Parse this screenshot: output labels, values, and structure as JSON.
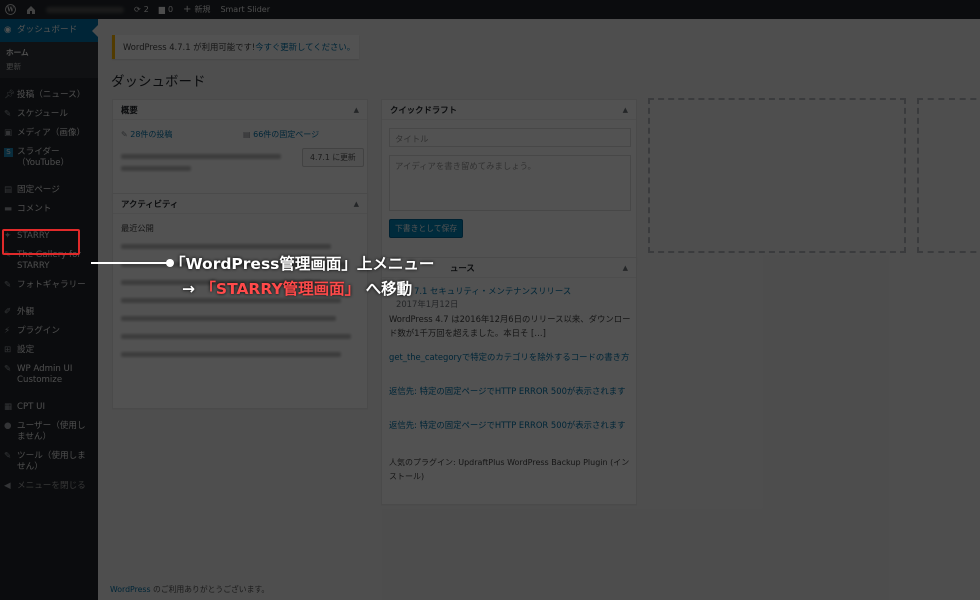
{
  "adminbar": {
    "updates_count": "2",
    "comments_count": "0",
    "new_label": "新規",
    "smart_slider_label": "Smart Slider"
  },
  "sidebar": {
    "dashboard": "ダッシュボード",
    "sub_home": "ホーム",
    "sub_update": "更新",
    "items": [
      {
        "label": "投稿（ニュース）",
        "icon": "pin-icon"
      },
      {
        "label": "スケジュール",
        "icon": "pin-icon"
      },
      {
        "label": "メディア（画像）",
        "icon": "media-icon"
      },
      {
        "label": "スライダー（YouTube）",
        "icon": "slider-icon"
      },
      {
        "label": "固定ページ",
        "icon": "page-icon"
      },
      {
        "label": "コメント",
        "icon": "comment-icon"
      },
      {
        "label": "STARRY",
        "icon": "starry-icon"
      },
      {
        "label": "The Gallery for STARRY",
        "icon": "pin-icon"
      },
      {
        "label": "フォトギャラリー",
        "icon": "pin-icon"
      },
      {
        "label": "外観",
        "icon": "brush-icon"
      },
      {
        "label": "プラグイン",
        "icon": "plugin-icon"
      },
      {
        "label": "設定",
        "icon": "settings-icon"
      },
      {
        "label": "WP Admin UI Customize",
        "icon": "wrench-icon"
      },
      {
        "label": "CPT UI",
        "icon": "grid-icon"
      },
      {
        "label": "ユーザー（使用しません）",
        "icon": "user-icon"
      },
      {
        "label": "ツール（使用しません）",
        "icon": "wrench-icon"
      },
      {
        "label": "メニューを閉じる",
        "icon": "collapse-icon"
      }
    ]
  },
  "notice": {
    "text": "WordPress 4.7.1 が利用可能です! ",
    "link": "今すぐ更新してください。"
  },
  "page_title": "ダッシュボード",
  "glance": {
    "title": "概要",
    "posts": "28件の投稿",
    "pages": "66件の固定ページ",
    "update_button": "4.7.1 に更新"
  },
  "activity": {
    "title": "アクティビティ",
    "recent": "最近公開"
  },
  "quickdraft": {
    "title": "クイックドラフト",
    "title_placeholder": "タイトル",
    "content_placeholder": "アイディアを書き留めてみましょう。",
    "save_button": "下書きとして保存"
  },
  "news": {
    "title_fragment": "ュース",
    "item1_title": "7.1 セキュリティ・メンテナンスリリース",
    "item1_date": "2017年1月12日",
    "item1_text": "WordPress 4.7 は2016年12月6日のリリース以来、ダウンロード数が1千万回を超えました。本日そ […]",
    "item2": "get_the_categoryで特定のカテゴリを除外するコードの書き方",
    "item3": "返信先: 特定の固定ページでHTTP ERROR 500が表示されます",
    "item4": "返信先: 特定の固定ページでHTTP ERROR 500が表示されます",
    "popular": "人気のプラグイン: UpdraftPlus WordPress Backup Plugin (インストール)"
  },
  "footer": {
    "link": "WordPress",
    "text": " のご利用ありがとうございます。"
  },
  "annotation": {
    "line1": "「WordPress管理画面」上メニュー",
    "line2_arrow": "→",
    "line2_red": "「STARRY管理画面」",
    "line2_rest": "へ移動"
  },
  "colors": {
    "accent": "#0073aa",
    "highlight": "#e02a2a"
  }
}
